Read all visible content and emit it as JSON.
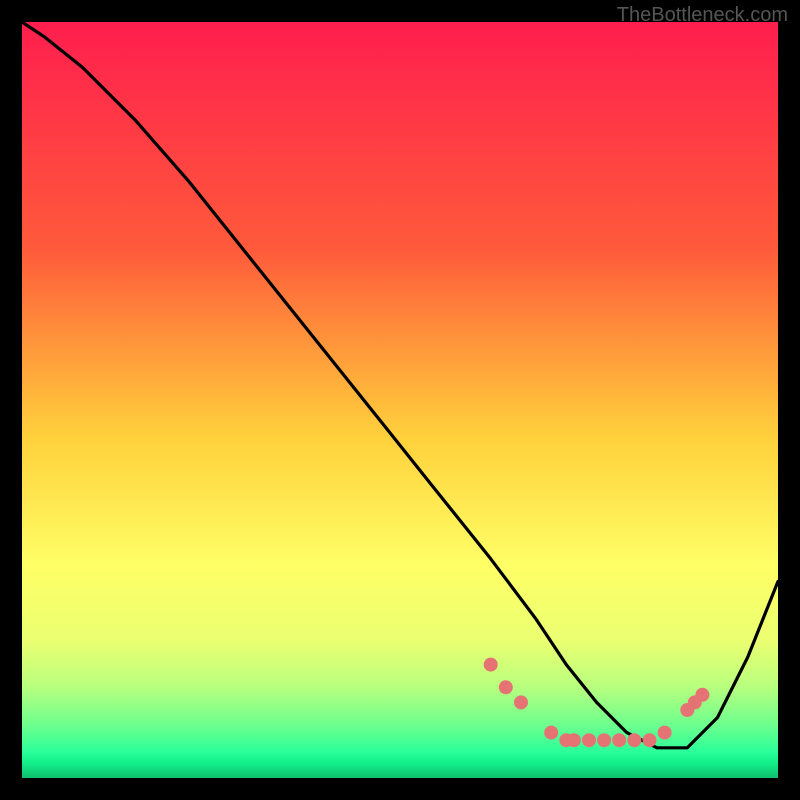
{
  "watermark": "TheBottleneck.com",
  "chart_data": {
    "type": "line",
    "title": "",
    "xlabel": "",
    "ylabel": "",
    "xlim": [
      0,
      100
    ],
    "ylim": [
      0,
      100
    ],
    "series": [
      {
        "name": "curve",
        "x": [
          0,
          3,
          8,
          15,
          22,
          30,
          38,
          46,
          54,
          62,
          68,
          72,
          76,
          80,
          84,
          88,
          92,
          96,
          100
        ],
        "y": [
          100,
          98,
          94,
          87,
          79,
          69,
          59,
          49,
          39,
          29,
          21,
          15,
          10,
          6,
          4,
          4,
          8,
          16,
          26
        ]
      }
    ],
    "markers": {
      "name": "dots",
      "color": "#e57373",
      "points": [
        {
          "x": 62,
          "y": 15
        },
        {
          "x": 64,
          "y": 12
        },
        {
          "x": 66,
          "y": 10
        },
        {
          "x": 70,
          "y": 6
        },
        {
          "x": 72,
          "y": 5
        },
        {
          "x": 73,
          "y": 5
        },
        {
          "x": 75,
          "y": 5
        },
        {
          "x": 77,
          "y": 5
        },
        {
          "x": 79,
          "y": 5
        },
        {
          "x": 81,
          "y": 5
        },
        {
          "x": 83,
          "y": 5
        },
        {
          "x": 85,
          "y": 6
        },
        {
          "x": 88,
          "y": 9
        },
        {
          "x": 89,
          "y": 10
        },
        {
          "x": 90,
          "y": 11
        }
      ]
    }
  }
}
